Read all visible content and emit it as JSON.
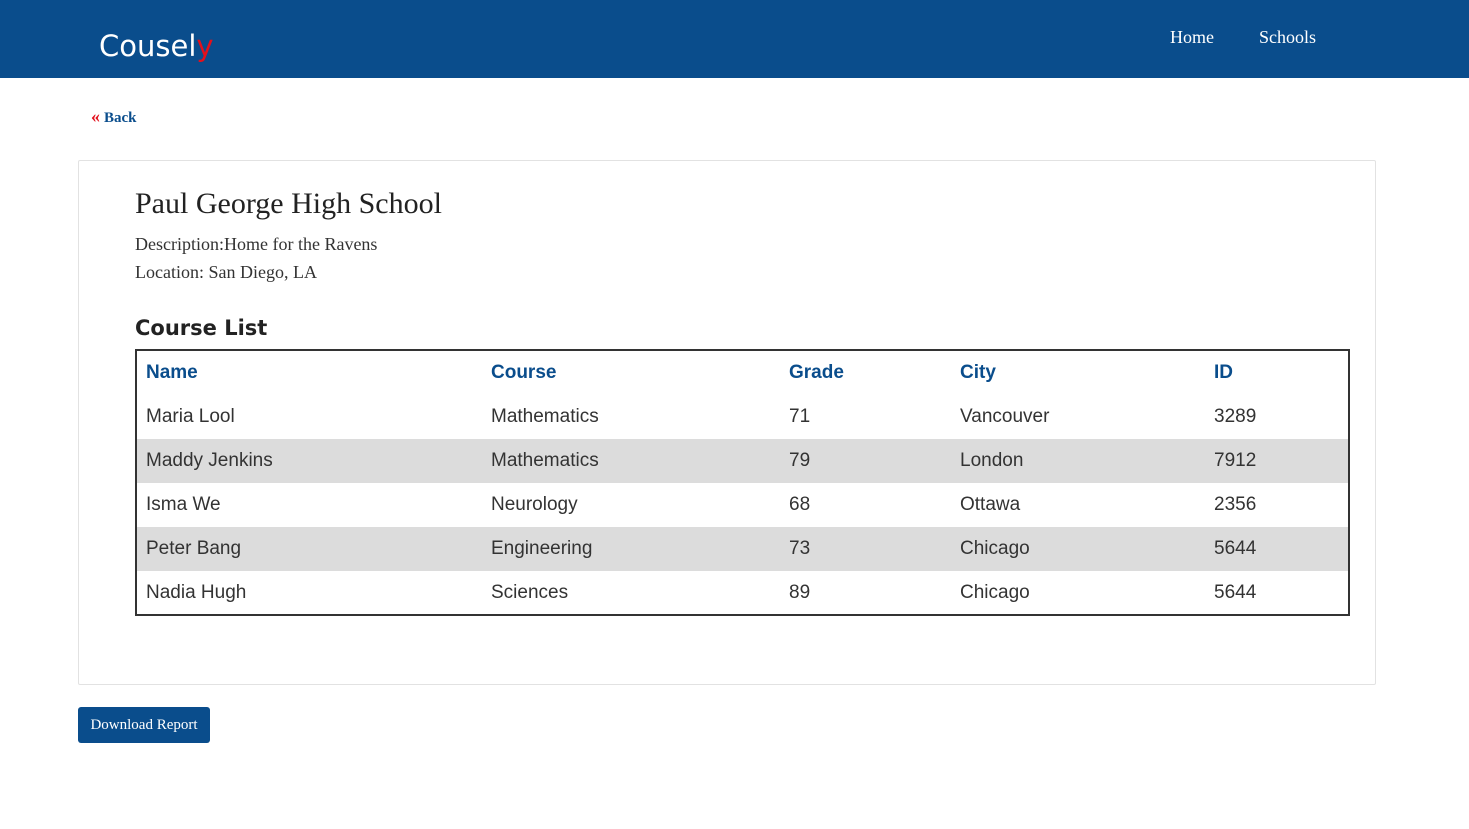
{
  "header": {
    "brand_main": "Cousel",
    "brand_accent": "y",
    "nav": [
      {
        "label": "Home"
      },
      {
        "label": "Schools"
      }
    ]
  },
  "back": {
    "icon": "double-chevron-left-icon",
    "label": "Back"
  },
  "school": {
    "title": "Paul George High School",
    "description": "Description:Home for the Ravens",
    "location": "Location: San Diego, LA"
  },
  "course_list": {
    "heading": "Course List",
    "columns": [
      "Name",
      "Course",
      "Grade",
      "City",
      "ID"
    ],
    "rows": [
      {
        "name": "Maria Lool",
        "course": "Mathematics",
        "grade": "71",
        "city": "Vancouver",
        "id": "3289"
      },
      {
        "name": "Maddy Jenkins",
        "course": "Mathematics",
        "grade": "79",
        "city": "London",
        "id": "7912"
      },
      {
        "name": "Isma We",
        "course": "Neurology",
        "grade": "68",
        "city": "Ottawa",
        "id": "2356"
      },
      {
        "name": "Peter Bang",
        "course": "Engineering",
        "grade": "73",
        "city": "Chicago",
        "id": "5644"
      },
      {
        "name": "Nadia Hugh",
        "course": "Sciences",
        "grade": "89",
        "city": "Chicago",
        "id": "5644"
      }
    ]
  },
  "actions": {
    "download_label": "Download Report"
  },
  "colors": {
    "brand_blue": "#0a4d8c",
    "accent_red": "#e3101c",
    "row_alt": "#dcdcdc"
  }
}
